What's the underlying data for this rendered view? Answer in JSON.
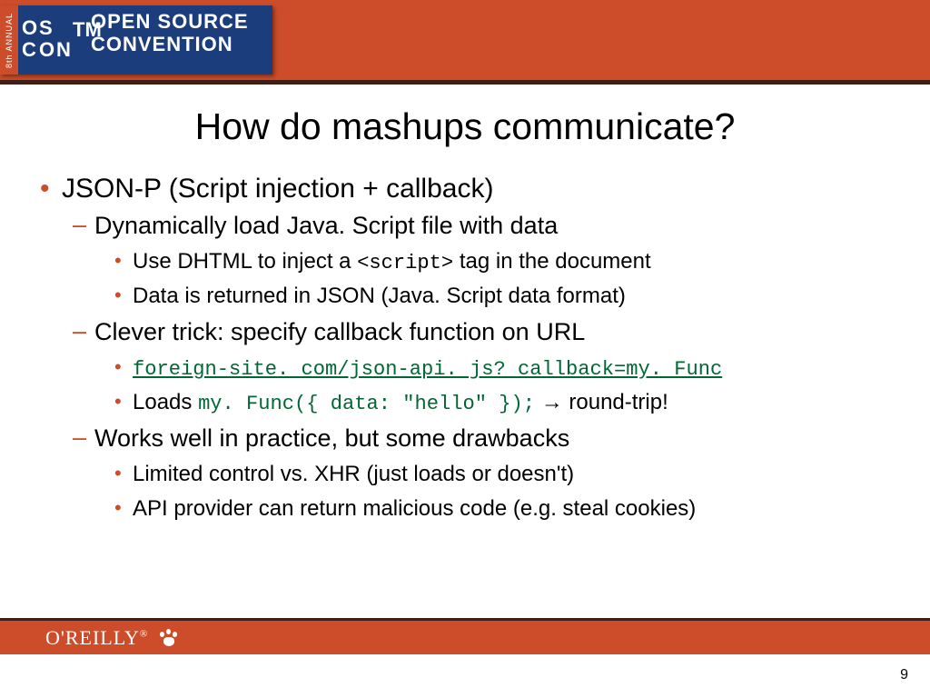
{
  "banner": {
    "annual": "8th ANNUAL",
    "logo_letters": [
      "O",
      "S",
      "C",
      "O",
      "N"
    ],
    "tm": "TM",
    "title_line1": "OPEN SOURCE",
    "title_line2": "CONVENTION"
  },
  "slide": {
    "title": "How do mashups communicate?",
    "bullet1": "JSON-P (Script injection + callback)",
    "sub1": "Dynamically load Java. Script file with data",
    "sub1_a_pre": "Use DHTML to inject a ",
    "sub1_a_code": "<script>",
    "sub1_a_post": " tag in the document",
    "sub1_b": "Data is returned in JSON (Java. Script data format)",
    "sub2": "Clever trick: specify callback function on URL",
    "sub2_a_code": "foreign-site. com/json-api. js? callback=my. Func",
    "sub2_b_pre": "Loads ",
    "sub2_b_code": "my. Func({ data: \"hello\" });",
    "sub2_b_arrow": " → ",
    "sub2_b_post": "round-trip!",
    "sub3": "Works well in practice, but some drawbacks",
    "sub3_a": "Limited control vs. XHR (just loads or doesn't)",
    "sub3_b": "API provider can return malicious code (e.g. steal cookies)"
  },
  "footer": {
    "brand": "O'REILLY",
    "reg": "®",
    "page": "9"
  }
}
